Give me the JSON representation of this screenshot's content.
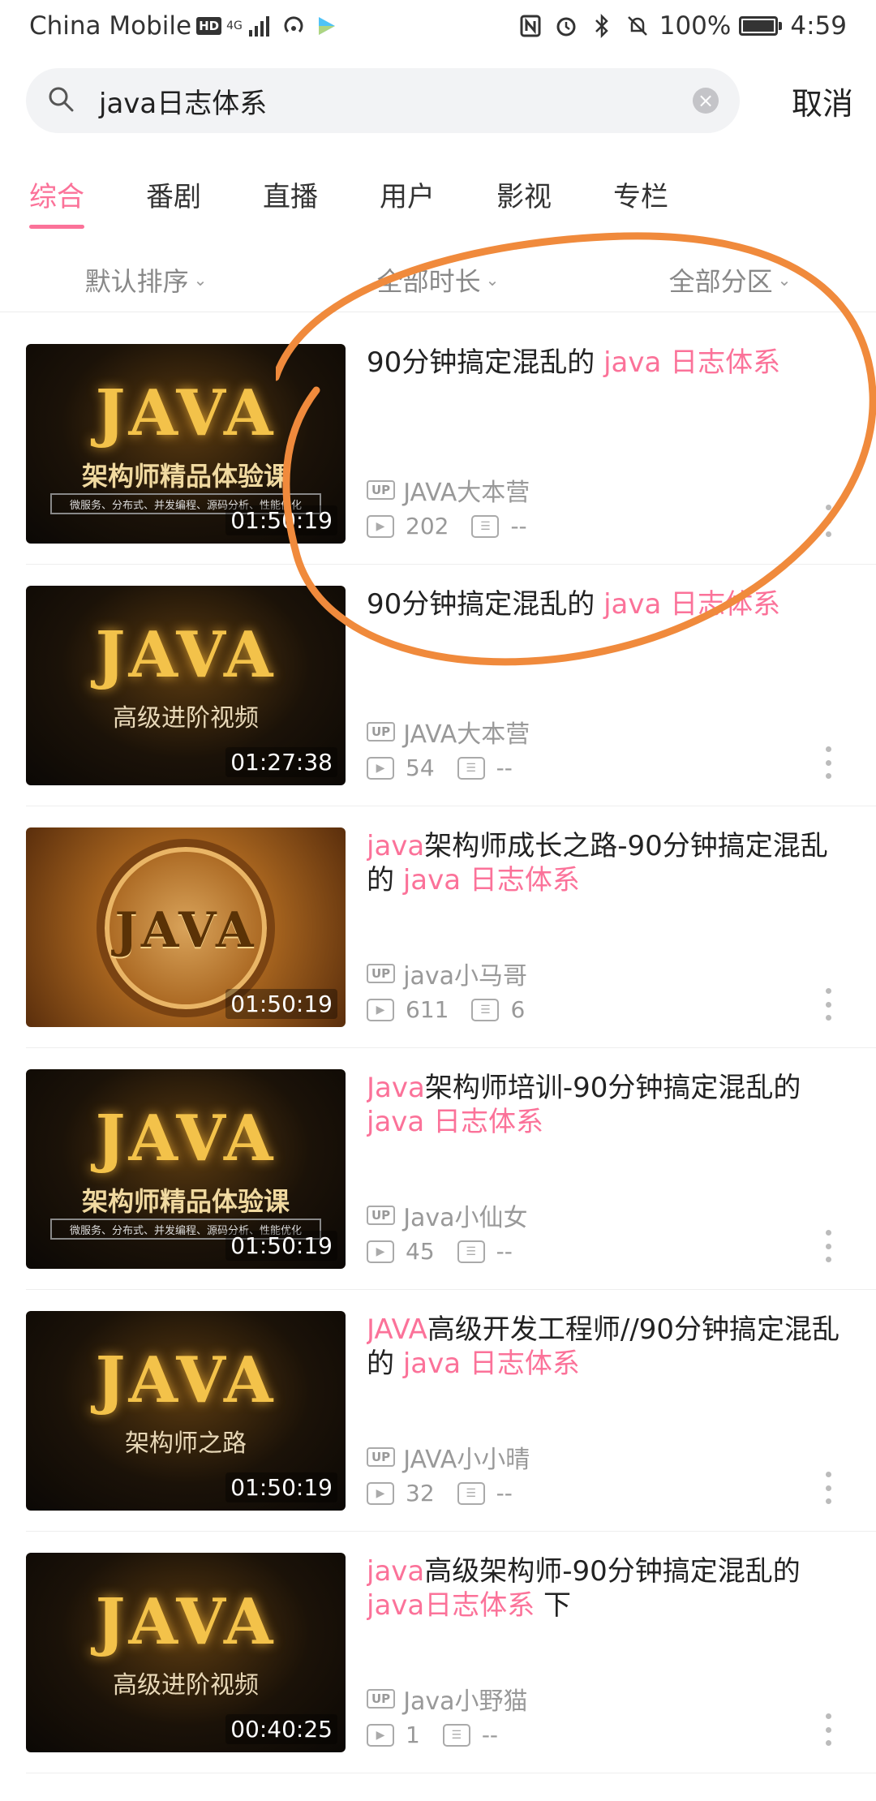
{
  "status_bar": {
    "carrier": "China Mobile",
    "hd_badge": "HD",
    "network": "4G",
    "battery_percent": "100%",
    "time": "4:59"
  },
  "search": {
    "query": "java日志体系",
    "cancel_label": "取消"
  },
  "tabs": [
    {
      "label": "综合",
      "active": true
    },
    {
      "label": "番剧"
    },
    {
      "label": "直播"
    },
    {
      "label": "用户"
    },
    {
      "label": "影视"
    },
    {
      "label": "专栏"
    }
  ],
  "filters": [
    {
      "label": "默认排序"
    },
    {
      "label": "全部时长"
    },
    {
      "label": "全部分区"
    }
  ],
  "results": [
    {
      "title_parts": [
        {
          "t": "90分钟搞定混乱的 "
        },
        {
          "t": "java 日志体系",
          "hl": true
        }
      ],
      "uploader": "JAVA大本营",
      "views": "202",
      "danmaku": "--",
      "duration": "01:50:19",
      "thumb_text": "JAVA",
      "thumb_sub": "架构师精品体验课",
      "thumb_strip": "微服务、分布式、并发编程、源码分析、性能优化",
      "thumb_style": "dark"
    },
    {
      "title_parts": [
        {
          "t": "90分钟搞定混乱的 "
        },
        {
          "t": "java 日志体系",
          "hl": true
        }
      ],
      "uploader": "JAVA大本营",
      "views": "54",
      "danmaku": "--",
      "duration": "01:27:38",
      "thumb_text": "JAVA",
      "thumb_sub": "高级进阶视频",
      "thumb_style": "dark"
    },
    {
      "title_parts": [
        {
          "t": "java",
          "hl": true
        },
        {
          "t": "架构师成长之路-90分钟搞定混乱的 "
        },
        {
          "t": "java 日志体系",
          "hl": true
        }
      ],
      "uploader": "java小马哥",
      "views": "611",
      "danmaku": "6",
      "duration": "01:50:19",
      "thumb_text": "JAVA",
      "thumb_style": "coin"
    },
    {
      "title_parts": [
        {
          "t": "Java",
          "hl": true
        },
        {
          "t": "架构师培训-90分钟搞定混乱的 "
        },
        {
          "t": "java 日志体系",
          "hl": true
        }
      ],
      "uploader": "Java小仙女",
      "views": "45",
      "danmaku": "--",
      "duration": "01:50:19",
      "thumb_text": "JAVA",
      "thumb_sub": "架构师精品体验课",
      "thumb_strip": "微服务、分布式、并发编程、源码分析、性能优化",
      "thumb_style": "dark"
    },
    {
      "title_parts": [
        {
          "t": "JAVA",
          "hl": true
        },
        {
          "t": "高级开发工程师//90分钟搞定混乱的 "
        },
        {
          "t": "java 日志体系",
          "hl": true
        }
      ],
      "uploader": "JAVA小小晴",
      "views": "32",
      "danmaku": "--",
      "duration": "01:50:19",
      "thumb_text": "JAVA",
      "thumb_sub": "架构师之路",
      "thumb_style": "dark"
    },
    {
      "title_parts": [
        {
          "t": "java",
          "hl": true
        },
        {
          "t": "高级架构师-90分钟搞定混乱的 "
        },
        {
          "t": "java日志体系",
          "hl": true
        },
        {
          "t": " 下"
        }
      ],
      "uploader": "Java小野猫",
      "views": "1",
      "danmaku": "--",
      "duration": "00:40:25",
      "thumb_text": "JAVA",
      "thumb_sub": "高级进阶视频",
      "thumb_style": "dark"
    }
  ],
  "colors": {
    "accent": "#fb7299",
    "annotation": "#f08a3c"
  }
}
